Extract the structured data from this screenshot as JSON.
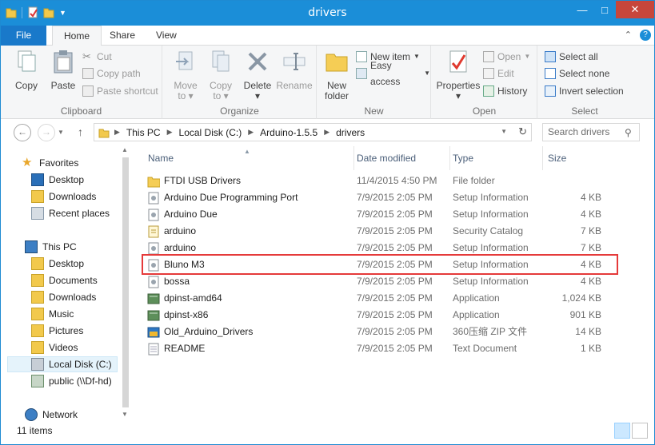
{
  "window": {
    "title": "drivers"
  },
  "tabs": {
    "file": "File",
    "home": "Home",
    "share": "Share",
    "view": "View"
  },
  "ribbon": {
    "clipboard": {
      "label": "Clipboard",
      "copy": "Copy",
      "paste": "Paste",
      "cut": "Cut",
      "copy_path": "Copy path",
      "paste_shortcut": "Paste shortcut"
    },
    "organize": {
      "label": "Organize",
      "move_to_1": "Move",
      "move_to_2": "to",
      "copy_to_1": "Copy",
      "copy_to_2": "to",
      "delete": "Delete",
      "rename": "Rename"
    },
    "new": {
      "label": "New",
      "new_folder_1": "New",
      "new_folder_2": "folder",
      "new_item": "New item",
      "easy_access": "Easy access"
    },
    "open": {
      "label": "Open",
      "properties": "Properties",
      "open": "Open",
      "edit": "Edit",
      "history": "History"
    },
    "select": {
      "label": "Select",
      "select_all": "Select all",
      "select_none": "Select none",
      "invert": "Invert selection"
    }
  },
  "address": {
    "crumbs": [
      "This PC",
      "Local Disk (C:)",
      "Arduino-1.5.5",
      "drivers"
    ]
  },
  "search": {
    "placeholder": "Search drivers"
  },
  "nav": {
    "favorites": "Favorites",
    "desktop": "Desktop",
    "downloads": "Downloads",
    "recent": "Recent places",
    "this_pc": "This PC",
    "pc_desktop": "Desktop",
    "documents": "Documents",
    "pc_downloads": "Downloads",
    "music": "Music",
    "pictures": "Pictures",
    "videos": "Videos",
    "local_disk": "Local Disk (C:)",
    "public": "public (\\\\Df-hd)",
    "network": "Network"
  },
  "columns": {
    "name": "Name",
    "date": "Date modified",
    "type": "Type",
    "size": "Size"
  },
  "files": [
    {
      "name": "FTDI USB Drivers",
      "date": "11/4/2015 4:50 PM",
      "type": "File folder",
      "size": "",
      "icon": "folder-icon"
    },
    {
      "name": "Arduino Due Programming Port",
      "date": "7/9/2015 2:05 PM",
      "type": "Setup Information",
      "size": "4 KB",
      "icon": "setup-info-icon"
    },
    {
      "name": "Arduino Due",
      "date": "7/9/2015 2:05 PM",
      "type": "Setup Information",
      "size": "4 KB",
      "icon": "setup-info-icon"
    },
    {
      "name": "arduino",
      "date": "7/9/2015 2:05 PM",
      "type": "Security Catalog",
      "size": "7 KB",
      "icon": "security-catalog-icon"
    },
    {
      "name": "arduino",
      "date": "7/9/2015 2:05 PM",
      "type": "Setup Information",
      "size": "7 KB",
      "icon": "setup-info-icon"
    },
    {
      "name": "Bluno M3",
      "date": "7/9/2015 2:05 PM",
      "type": "Setup Information",
      "size": "4 KB",
      "icon": "setup-info-icon"
    },
    {
      "name": "bossa",
      "date": "7/9/2015 2:05 PM",
      "type": "Setup Information",
      "size": "4 KB",
      "icon": "setup-info-icon"
    },
    {
      "name": "dpinst-amd64",
      "date": "7/9/2015 2:05 PM",
      "type": "Application",
      "size": "1,024 KB",
      "icon": "application-icon"
    },
    {
      "name": "dpinst-x86",
      "date": "7/9/2015 2:05 PM",
      "type": "Application",
      "size": "901 KB",
      "icon": "application-icon"
    },
    {
      "name": "Old_Arduino_Drivers",
      "date": "7/9/2015 2:05 PM",
      "type": "360压缩 ZIP 文件",
      "size": "14 KB",
      "icon": "zip-archive-icon"
    },
    {
      "name": "README",
      "date": "7/9/2015 2:05 PM",
      "type": "Text Document",
      "size": "1 KB",
      "icon": "text-document-icon"
    }
  ],
  "status": {
    "count": "11 items"
  },
  "colors": {
    "accent": "#1b8ed8",
    "close": "#c7463b",
    "highlight": "#e53a3a",
    "file_tab": "#1979ca"
  }
}
